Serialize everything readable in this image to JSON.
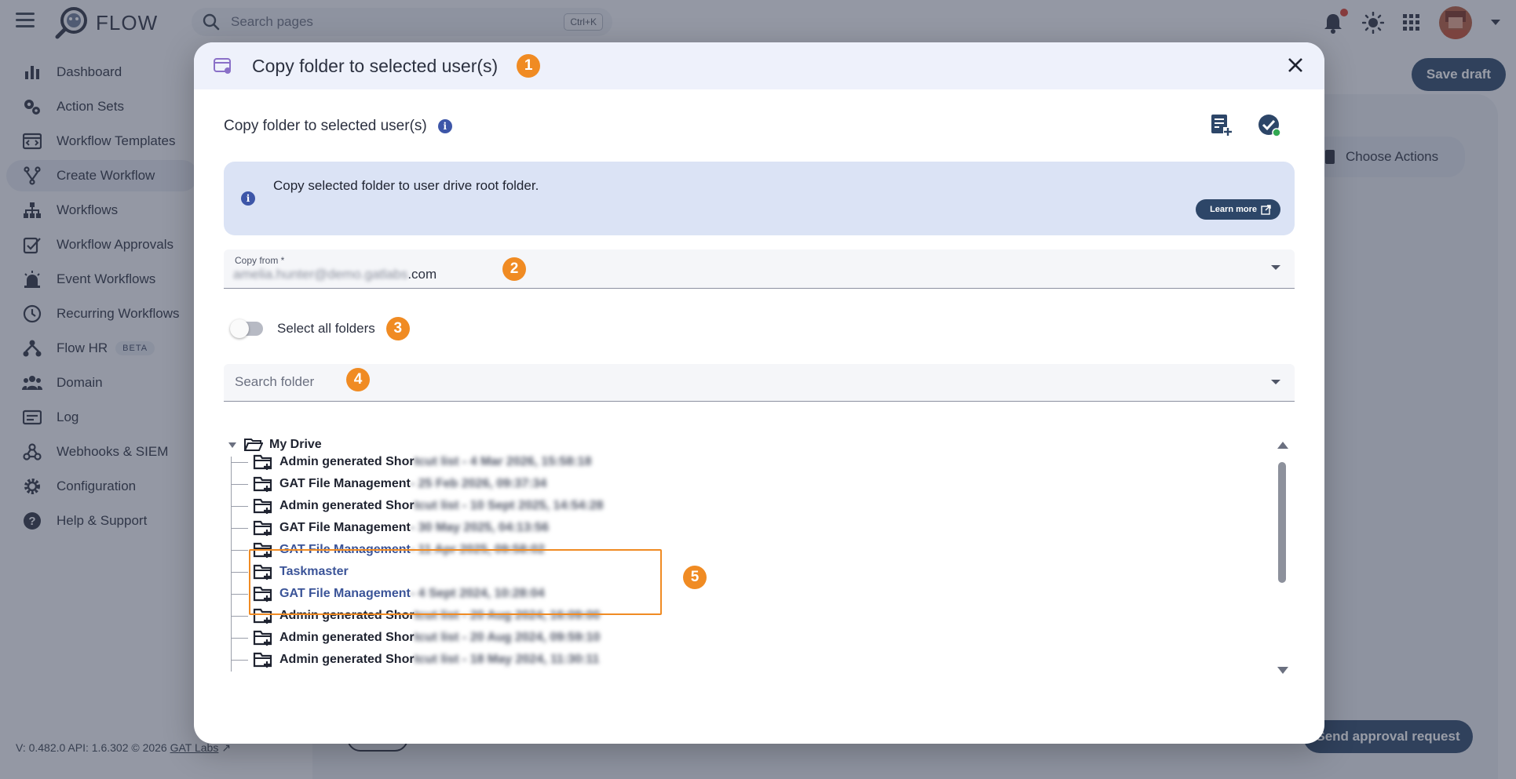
{
  "app": {
    "brand": "FLOW",
    "search_placeholder": "Search pages",
    "search_shortcut": "Ctrl+K",
    "save_draft": "Save draft",
    "choose_actions": "Choose Actions",
    "send_approval": "Send approval request",
    "version": "V: 0.482.0  API: 1.6.302  © 2026",
    "version_link": "GAT Labs"
  },
  "sidebar": {
    "items": [
      {
        "label": "Dashboard",
        "icon": "bar-chart-icon"
      },
      {
        "label": "Action Sets",
        "icon": "gears-icon"
      },
      {
        "label": "Workflow Templates",
        "icon": "template-icon"
      },
      {
        "label": "Create Workflow",
        "icon": "fork-icon",
        "active": true
      },
      {
        "label": "Workflows",
        "icon": "hierarchy-icon"
      },
      {
        "label": "Workflow Approvals",
        "icon": "approval-icon"
      },
      {
        "label": "Event Workflows",
        "icon": "alarm-icon"
      },
      {
        "label": "Recurring Workflows",
        "icon": "clock-icon"
      },
      {
        "label": "Flow HR",
        "icon": "hr-icon",
        "badge": "BETA"
      },
      {
        "label": "Domain",
        "icon": "people-icon"
      },
      {
        "label": "Log",
        "icon": "log-icon"
      },
      {
        "label": "Webhooks & SIEM",
        "icon": "webhook-icon"
      },
      {
        "label": "Configuration",
        "icon": "gear-icon"
      },
      {
        "label": "Help & Support",
        "icon": "help-icon"
      }
    ]
  },
  "modal": {
    "title": "Copy folder to selected user(s)",
    "section_title": "Copy folder to selected user(s)",
    "info_text": "Copy selected folder to user drive root folder.",
    "learn_more": "Learn more",
    "copy_from_label": "Copy from *",
    "copy_from_value_hidden": "amelia.hunter@demo.gatlabs",
    "copy_from_value_suffix": ".com",
    "select_all_label": "Select all folders",
    "select_all_on": false,
    "search_placeholder": "Search folder",
    "steps": [
      "1",
      "2",
      "3",
      "4",
      "5"
    ],
    "tree": {
      "root": "My Drive",
      "items": [
        {
          "name": "Admin generated Shor",
          "suffix": "tcut list - 4 Mar 2026, 15:58:18",
          "hl": false
        },
        {
          "name": "GAT File Management",
          "suffix": " - 25 Feb 2026, 09:37:34",
          "hl": false
        },
        {
          "name": "Admin generated Shor",
          "suffix": "tcut list - 10 Sept 2025, 14:54:28",
          "hl": false
        },
        {
          "name": "GAT File Management",
          "suffix": " - 30 May 2025, 04:13:56",
          "hl": false
        },
        {
          "name": "GAT File Management",
          "suffix": " - 11 Apr 2025, 09:58:02",
          "hl": true
        },
        {
          "name": "Taskmaster",
          "suffix": "",
          "hl": true
        },
        {
          "name": "GAT File Management",
          "suffix": " - 4 Sept 2024, 10:28:04",
          "hl": true
        },
        {
          "name": "Admin generated Shor",
          "suffix": "tcut list - 20 Aug 2024, 16:09:00",
          "hl": false
        },
        {
          "name": "Admin generated Shor",
          "suffix": "tcut list - 20 Aug 2024, 09:59:10",
          "hl": false
        },
        {
          "name": "Admin generated Shor",
          "suffix": "tcut list - 18 May 2024, 11:30:11",
          "hl": false
        }
      ]
    }
  },
  "colors": {
    "accent": "#2d4668",
    "step_badge": "#f08b23",
    "highlight_text": "#3b5498",
    "info_box": "#dbe3f5"
  }
}
